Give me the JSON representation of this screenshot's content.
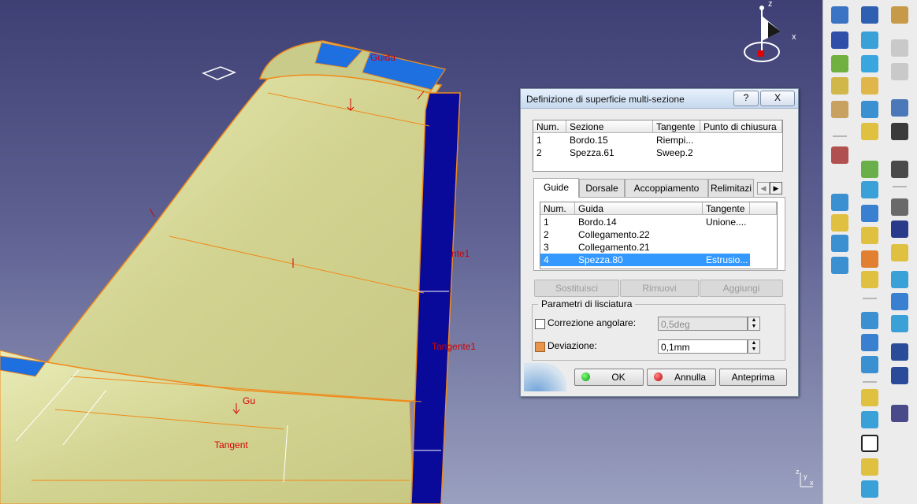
{
  "viewport": {
    "labels": {
      "guida_top": "Guida",
      "tangente_right": "Tangente1",
      "tangente_bottom": "Tangent",
      "gu_bottom": "Gu",
      "partial_right": "nte1"
    },
    "compass_axes": {
      "x": "x",
      "z": "z"
    },
    "mini_axes": {
      "z": "z",
      "y": "y",
      "x": "x"
    }
  },
  "dialog": {
    "title": "Definizione di superficie multi-sezione",
    "help_label": "?",
    "close_label": "X",
    "sections_table": {
      "headers": [
        "Num.",
        "Sezione",
        "Tangente",
        "Punto di chiusura"
      ],
      "rows": [
        {
          "num": "1",
          "sezione": "Bordo.15",
          "tangente": "Riempi...",
          "punto": ""
        },
        {
          "num": "2",
          "sezione": "Spezza.61",
          "tangente": "Sweep.2",
          "punto": ""
        }
      ]
    },
    "tabs": [
      "Guide",
      "Dorsale",
      "Accoppiamento",
      "Relimitazi"
    ],
    "active_tab": "Guide",
    "guides_table": {
      "headers": [
        "Num.",
        "Guida",
        "Tangente"
      ],
      "rows": [
        {
          "num": "1",
          "guida": "Bordo.14",
          "tangente": "Unione...."
        },
        {
          "num": "2",
          "guida": "Collegamento.22",
          "tangente": ""
        },
        {
          "num": "3",
          "guida": "Collegamento.21",
          "tangente": ""
        },
        {
          "num": "4",
          "guida": "Spezza.80",
          "tangente": "Estrusio..."
        }
      ],
      "selected_row": 4
    },
    "buttons": {
      "replace": "Sostituisci",
      "remove": "Rimuovi",
      "add": "Aggiungi"
    },
    "smoothing": {
      "group_label": "Parametri di lisciatura",
      "angular_label": "Correzione angolare:",
      "angular_value": "0,5deg",
      "angular_checked": false,
      "deviation_label": "Deviazione:",
      "deviation_value": "0,1mm",
      "deviation_checked": true
    },
    "footer": {
      "ok": "OK",
      "cancel": "Annulla",
      "preview": "Anteprima"
    }
  },
  "colors": {
    "surface": "#d8d99a",
    "edge_orange": "#f08a1a",
    "dark_blue": "#0a0a9a",
    "light_blue": "#1e6fe0",
    "selection": "#3399ff"
  }
}
